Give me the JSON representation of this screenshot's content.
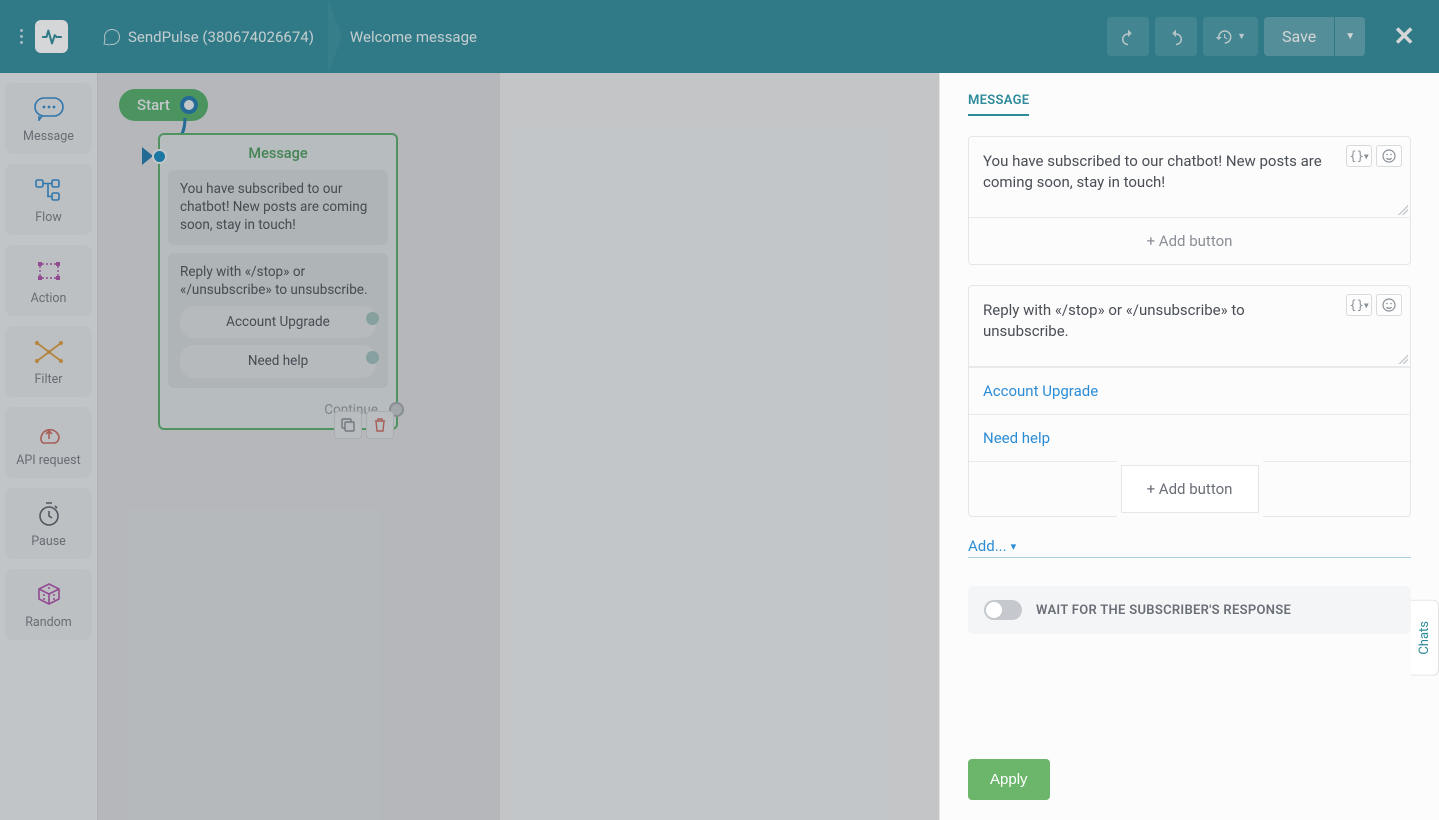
{
  "header": {
    "breadcrumb_bot": "SendPulse (380674026674)",
    "breadcrumb_flow": "Welcome message",
    "save_label": "Save"
  },
  "sidebar": {
    "items": [
      {
        "label": "Message"
      },
      {
        "label": "Flow"
      },
      {
        "label": "Action"
      },
      {
        "label": "Filter"
      },
      {
        "label": "API request"
      },
      {
        "label": "Pause"
      },
      {
        "label": "Random"
      }
    ]
  },
  "canvas": {
    "start_label": "Start",
    "node_title": "Message",
    "block1_text": "You have subscribed to our chatbot! New posts are coming soon, stay in touch!",
    "block2_text": "Reply with «/stop» or «/unsubscribe» to unsubscribe.",
    "btn1": "Account Upgrade",
    "btn2": "Need help",
    "continue_label": "Continue"
  },
  "panel": {
    "title": "MESSAGE",
    "text1": "You have subscribed to our chatbot! New posts are coming soon, stay in touch!",
    "text2": "Reply with «/stop» or «/unsubscribe» to unsubscribe.",
    "link1": "Account Upgrade",
    "link2": "Need help",
    "add_button_label": "+ Add button",
    "add_dd_label": "Add...",
    "toggle_label": "WAIT FOR THE SUBSCRIBER'S RESPONSE",
    "apply_label": "Apply"
  },
  "chats_tab": "Chats"
}
